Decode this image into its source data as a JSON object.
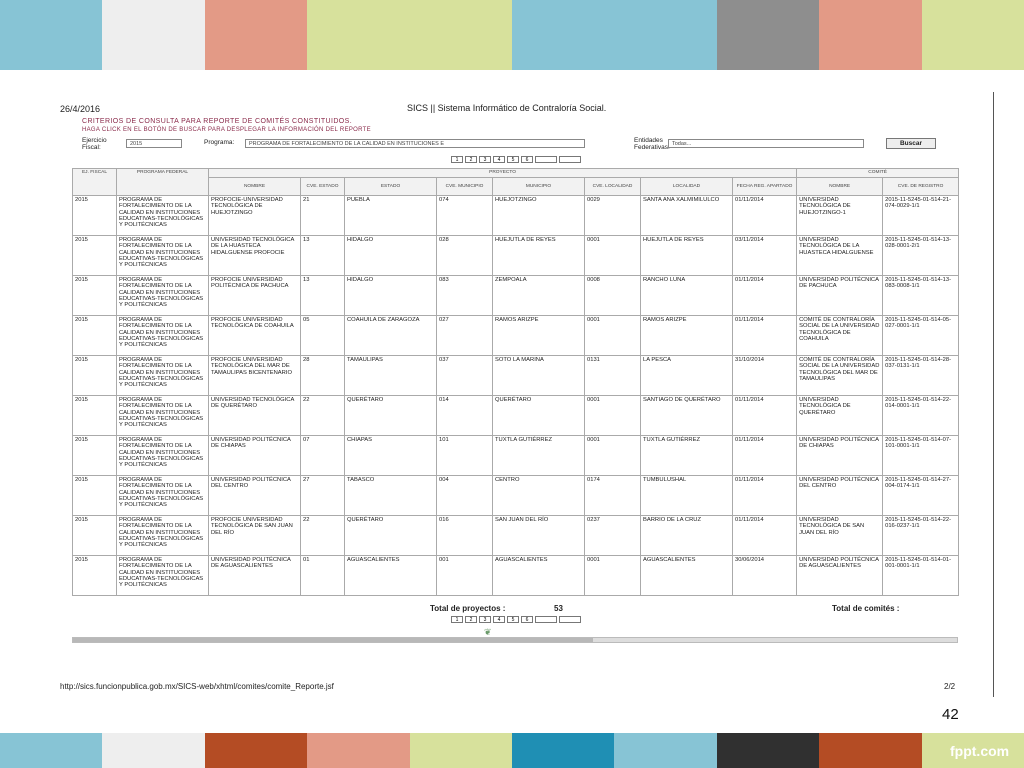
{
  "frame": {
    "top_band_colors": [
      "#87c4d5",
      "#eeeeee",
      "#e39a86",
      "#d7e19c",
      "#d7e19c",
      "#87c4d5",
      "#87c4d5",
      "#8e8e8e",
      "#e39a86",
      "#d7e19c"
    ],
    "bottom_band_colors": [
      "#87c4d5",
      "#eeeeee",
      "#b44c24",
      "#e39a86",
      "#d7e19c",
      "#1f8fb4",
      "#87c4d5",
      "#303030",
      "#b44c24",
      "#d7e19c"
    ],
    "slide_number": "42",
    "brand": "fppt.com"
  },
  "doc": {
    "date": "26/4/2016",
    "title": "SICS || Sistema Informático de Contraloría Social.",
    "heading": "Criterios de consulta para reporte de comités constituidos.",
    "instructions": "Haga click en el botón de Buscar para desplegar la información del reporte",
    "url": "http://sics.funcionpublica.gob.mx/SICS-web/xhtml/comites/comite_Reporte.jsf",
    "page": "2/2",
    "logo_icon": "leaf-logo-icon"
  },
  "filters": {
    "ejercicio_label": "Ejercicio Fiscal:",
    "ejercicio_value": "2015",
    "programa_label": "Programa:",
    "programa_value": "PROGRAMA DE FORTALECIMIENTO DE LA CALIDAD EN INSTITUCIONES E",
    "entidades_label": "Entidades Federativas:",
    "entidades_value": "Todas...",
    "search_label": "Buscar"
  },
  "pager": {
    "pages": [
      "1",
      "2",
      "3",
      "4",
      "5",
      "6"
    ]
  },
  "table": {
    "group_headers": {
      "proyecto": "Proyecto",
      "comite": "Comité"
    },
    "columns": {
      "ejercicio": "Ej. Fiscal",
      "programa": "Programa Federal",
      "nombre": "Nombre",
      "cve_estado": "Cve. Estado",
      "estado": "Estado",
      "cve_municipio": "Cve. Municipio",
      "municipio": "Municipio",
      "cve_localidad": "Cve. Localidad",
      "localidad": "Localidad",
      "fecha": "Fecha Reg. Apartado",
      "comite_nombre": "Nombre",
      "cve_registro": "Cve. de Registro"
    },
    "rows": [
      {
        "ejercicio": "2015",
        "programa": "PROGRAMA DE FORTALECIMIENTO DE LA CALIDAD EN INSTITUCIONES EDUCATIVAS-TECNOLÓGICAS Y POLITÉCNICAS",
        "nombre": "PROFOCIE-UNIVERSIDAD TECNOLÓGICA DE HUEJOTZINGO",
        "cve_estado": "21",
        "estado": "PUEBLA",
        "cve_municipio": "074",
        "municipio": "HUEJOTZINGO",
        "cve_localidad": "0029",
        "localidad": "SANTA ANA XALMIMILULCO",
        "fecha": "01/11/2014",
        "comite": "UNIVERSIDAD TECNOLÓGICA DE HUEJOTZINGO-1",
        "registro": "2015-11-5245-01-514-21-074-0029-1/1"
      },
      {
        "ejercicio": "2015",
        "programa": "PROGRAMA DE FORTALECIMIENTO DE LA CALIDAD EN INSTITUCIONES EDUCATIVAS-TECNOLÓGICAS Y POLITÉCNICAS",
        "nombre": "UNIVERSIDAD TECNOLÓGICA DE LA HUASTECA HIDALGUENSE PROFOCIE",
        "cve_estado": "13",
        "estado": "HIDALGO",
        "cve_municipio": "028",
        "municipio": "HUEJUTLA DE REYES",
        "cve_localidad": "0001",
        "localidad": "HUEJUTLA DE REYES",
        "fecha": "03/11/2014",
        "comite": "UNIVERSIDAD TECNOLÓGICA DE LA HUASTECA HIDALGUENSE",
        "registro": "2015-11-5245-01-514-13-028-0001-2/1"
      },
      {
        "ejercicio": "2015",
        "programa": "PROGRAMA DE FORTALECIMIENTO DE LA CALIDAD EN INSTITUCIONES EDUCATIVAS-TECNOLÓGICAS Y POLITÉCNICAS",
        "nombre": "PROFOCIE UNIVERSIDAD POLITÉCNICA DE PACHUCA",
        "cve_estado": "13",
        "estado": "HIDALGO",
        "cve_municipio": "083",
        "municipio": "ZEMPOALA",
        "cve_localidad": "0008",
        "localidad": "RANCHO LUNA",
        "fecha": "01/11/2014",
        "comite": "UNIVERSIDAD POLITÉCNICA DE PACHUCA",
        "registro": "2015-11-5245-01-514-13-083-0008-1/1"
      },
      {
        "ejercicio": "2015",
        "programa": "PROGRAMA DE FORTALECIMIENTO DE LA CALIDAD EN INSTITUCIONES EDUCATIVAS-TECNOLÓGICAS Y POLITÉCNICAS",
        "nombre": "PROFOCIE UNIVERSIDAD TECNOLÓGICA DE COAHUILA",
        "cve_estado": "05",
        "estado": "COAHUILA DE ZARAGOZA",
        "cve_municipio": "027",
        "municipio": "RAMOS ARIZPE",
        "cve_localidad": "0001",
        "localidad": "RAMOS ARIZPE",
        "fecha": "01/11/2014",
        "comite": "COMITÉ DE CONTRALORÍA SOCIAL DE LA UNIVERSIDAD TECNOLÓGICA DE COAHUILA",
        "registro": "2015-11-5245-01-514-05-027-0001-1/1"
      },
      {
        "ejercicio": "2015",
        "programa": "PROGRAMA DE FORTALECIMIENTO DE LA CALIDAD EN INSTITUCIONES EDUCATIVAS-TECNOLÓGICAS Y POLITÉCNICAS",
        "nombre": "PROFOCIE UNIVERSIDAD TECNOLÓGICA DEL MAR DE TAMAULIPAS BICENTENARIO",
        "cve_estado": "28",
        "estado": "TAMAULIPAS",
        "cve_municipio": "037",
        "municipio": "SOTO LA MARINA",
        "cve_localidad": "0131",
        "localidad": "LA PESCA",
        "fecha": "31/10/2014",
        "comite": "COMITÉ DE CONTRALORÍA SOCIAL DE LA UNIVERSIDAD TECNOLÓGICA DEL MAR DE TAMAULIPAS",
        "registro": "2015-11-5245-01-514-28-037-0131-1/1"
      },
      {
        "ejercicio": "2015",
        "programa": "PROGRAMA DE FORTALECIMIENTO DE LA CALIDAD EN INSTITUCIONES EDUCATIVAS-TECNOLÓGICAS Y POLITÉCNICAS",
        "nombre": "UNIVERSIDAD TECNOLÓGICA DE QUERÉTARO",
        "cve_estado": "22",
        "estado": "QUERÉTARO",
        "cve_municipio": "014",
        "municipio": "QUERÉTARO",
        "cve_localidad": "0001",
        "localidad": "SANTIAGO DE QUERÉTARO",
        "fecha": "01/11/2014",
        "comite": "UNIVERSIDAD TECNOLÓGICA DE QUERÉTARO",
        "registro": "2015-11-5245-01-514-22-014-0001-1/1"
      },
      {
        "ejercicio": "2015",
        "programa": "PROGRAMA DE FORTALECIMIENTO DE LA CALIDAD EN INSTITUCIONES EDUCATIVAS-TECNOLÓGICAS Y POLITÉCNICAS",
        "nombre": "UNIVERSIDAD POLITÉCNICA DE CHIAPAS",
        "cve_estado": "07",
        "estado": "CHIAPAS",
        "cve_municipio": "101",
        "municipio": "TUXTLA GUTIÉRREZ",
        "cve_localidad": "0001",
        "localidad": "TUXTLA GUTIÉRREZ",
        "fecha": "01/11/2014",
        "comite": "UNIVERSIDAD POLITÉCNICA DE CHIAPAS",
        "registro": "2015-11-5245-01-514-07-101-0001-1/1"
      },
      {
        "ejercicio": "2015",
        "programa": "PROGRAMA DE FORTALECIMIENTO DE LA CALIDAD EN INSTITUCIONES EDUCATIVAS-TECNOLÓGICAS Y POLITÉCNICAS",
        "nombre": "UNIVERSIDAD POLITÉCNICA DEL CENTRO",
        "cve_estado": "27",
        "estado": "TABASCO",
        "cve_municipio": "004",
        "municipio": "CENTRO",
        "cve_localidad": "0174",
        "localidad": "TUMBULUSHAL",
        "fecha": "01/11/2014",
        "comite": "UNIVERSIDAD POLITÉCNICA DEL CENTRO",
        "registro": "2015-11-5245-01-514-27-004-0174-1/1"
      },
      {
        "ejercicio": "2015",
        "programa": "PROGRAMA DE FORTALECIMIENTO DE LA CALIDAD EN INSTITUCIONES EDUCATIVAS-TECNOLÓGICAS Y POLITÉCNICAS",
        "nombre": "PROFOCIE UNIVERSIDAD TECNOLÓGICA DE SAN JUAN DEL RÍO",
        "cve_estado": "22",
        "estado": "QUERÉTARO",
        "cve_municipio": "016",
        "municipio": "SAN JUAN DEL RÍO",
        "cve_localidad": "0237",
        "localidad": "BARRIO DE LA CRUZ",
        "fecha": "01/11/2014",
        "comite": "UNIVERSIDAD TECNOLÓGICA DE SAN JUAN DEL RÍO",
        "registro": "2015-11-5245-01-514-22-016-0237-1/1"
      },
      {
        "ejercicio": "2015",
        "programa": "PROGRAMA DE FORTALECIMIENTO DE LA CALIDAD EN INSTITUCIONES EDUCATIVAS-TECNOLÓGICAS Y POLITÉCNICAS",
        "nombre": "UNIVERSIDAD POLITÉCNICA DE AGUASCALIENTES",
        "cve_estado": "01",
        "estado": "AGUASCALIENTES",
        "cve_municipio": "001",
        "municipio": "AGUASCALIENTES",
        "cve_localidad": "0001",
        "localidad": "AGUASCALIENTES",
        "fecha": "30/06/2014",
        "comite": "UNIVERSIDAD POLITÉCNICA DE AGUASCALIENTES",
        "registro": "2015-11-5245-01-514-01-001-0001-1/1"
      }
    ]
  },
  "totals": {
    "proyectos_label": "Total de proyectos :",
    "proyectos_value": "53",
    "comites_label": "Total de comités :"
  }
}
